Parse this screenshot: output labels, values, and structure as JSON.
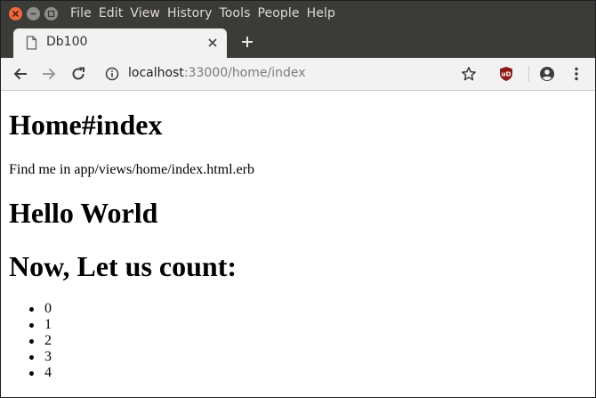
{
  "menubar": {
    "items": [
      "File",
      "Edit",
      "View",
      "History",
      "Tools",
      "People",
      "Help"
    ]
  },
  "window_controls": {
    "close_icon": "x-icon",
    "minimize_icon": "minus-icon",
    "maximize_icon": "square-icon"
  },
  "tab": {
    "title": "Db100",
    "icon": "document-icon",
    "close_icon": "close-icon"
  },
  "new_tab_icon": "plus-icon",
  "toolbar": {
    "back_icon": "arrow-left-icon",
    "forward_icon": "arrow-right-icon",
    "reload_icon": "reload-icon",
    "info_icon": "info-icon",
    "url_host": "localhost",
    "url_rest": ":33000/home/index",
    "bookmark_icon": "star-icon",
    "extension_icon": "ublock-icon",
    "extension_label": "uD",
    "account_icon": "account-icon",
    "menu_icon": "kebab-menu-icon"
  },
  "page": {
    "heading": "Home#index",
    "find_me": "Find me in app/views/home/index.html.erb",
    "hello": "Hello World",
    "count_heading": "Now, Let us count:",
    "count_items": [
      "0",
      "1",
      "2",
      "3",
      "4"
    ]
  },
  "colors": {
    "titlebar": "#3b3b38",
    "tab_bg": "#f2f2f2",
    "close_button": "#ec6a3f",
    "extension_badge": "#8e1b1b"
  }
}
